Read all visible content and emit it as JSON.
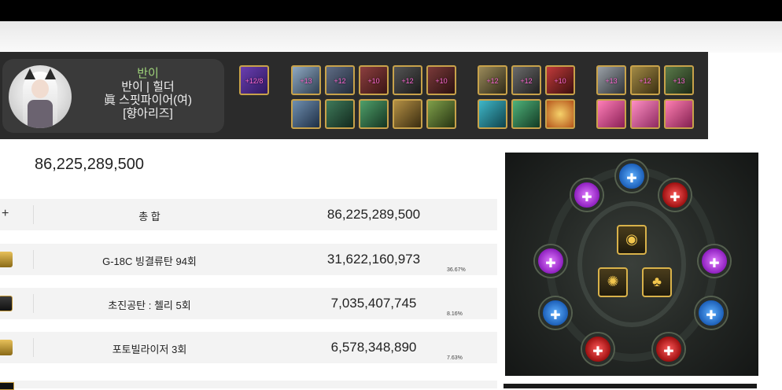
{
  "character": {
    "name": "반이",
    "guild_line": "반이 | 힐더",
    "class_line": "眞 스핏파이어(여)",
    "title_line": "[향아리즈]"
  },
  "equipment": {
    "first_slot_label": "+12/8",
    "top_row_levels": [
      "+13",
      "+12",
      "+10",
      "+12",
      "+10",
      "+12",
      "+12",
      "+10",
      "+13",
      "+12",
      "+13"
    ],
    "colors": {
      "slot_border": "#c8a24a",
      "level_text": "#ff6ad5"
    }
  },
  "damage": {
    "grand_total": "86,225,289,500",
    "rows": [
      {
        "icon": "plus-icon",
        "name": "총 합",
        "value": "86,225,289,500",
        "percent": ""
      },
      {
        "icon": "grenade-skill-icon",
        "name": "G-18C 빙결류탄 94회",
        "value": "31,622,160,973",
        "percent": "36.67%"
      },
      {
        "icon": "shell-skill-icon",
        "name": "초진공탄 : 첼리 5회",
        "value": "7,035,407,745",
        "percent": "8.16%"
      },
      {
        "icon": "fortifier-skill-icon",
        "name": "포토빌라이저 3회",
        "value": "6,578,348,890",
        "percent": "7.63%"
      }
    ]
  },
  "skill_tree": {
    "outer_nodes": [
      "purple",
      "blue",
      "red",
      "purple",
      "purple",
      "blue",
      "blue",
      "red",
      "red"
    ],
    "colors": {
      "blue": "#1c5fb8",
      "purple": "#8e1fbf",
      "red": "#9c1010",
      "gold": "#d9b24a"
    }
  }
}
